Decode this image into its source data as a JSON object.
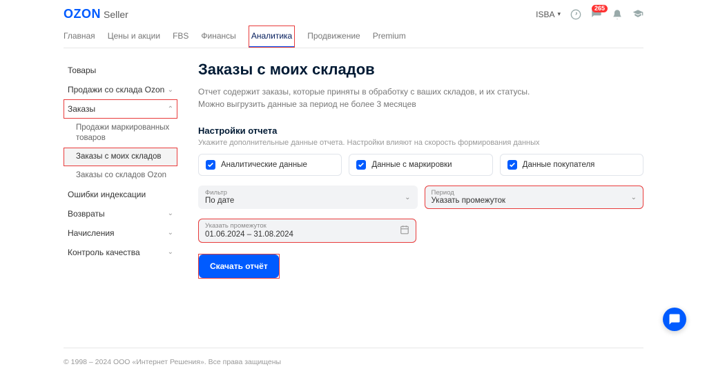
{
  "header": {
    "logo_main": "OZON",
    "logo_sub": "Seller",
    "user": "ISBA",
    "badge_count": "265"
  },
  "tabs": [
    "Главная",
    "Цены и акции",
    "FBS",
    "Финансы",
    "Аналитика",
    "Продвижение",
    "Premium"
  ],
  "active_tab_index": 4,
  "sidebar": {
    "items": [
      {
        "label": "Товары"
      },
      {
        "label": "Продажи со склада Ozon",
        "chev": "down"
      },
      {
        "label": "Заказы",
        "chev": "up",
        "highlight": true
      },
      {
        "label": "Ошибки индексации"
      },
      {
        "label": "Возвраты",
        "chev": "down"
      },
      {
        "label": "Начисления",
        "chev": "down"
      },
      {
        "label": "Контроль качества",
        "chev": "down"
      }
    ],
    "sub_items": [
      "Продажи маркированных товаров",
      "Заказы с моих складов",
      "Заказы со складов Ozon"
    ]
  },
  "content": {
    "title": "Заказы с моих складов",
    "description": "Отчет содержит заказы, которые приняты в обработку с ваших складов, и их статусы. Можно выгрузить данные за период не более 3 месяцев",
    "settings_head": "Настройки отчета",
    "settings_desc": "Укажите дополнительные данные отчета. Настройки влияют на скорость формирования данных",
    "checks": [
      "Аналитические данные",
      "Данные с маркировки",
      "Данные покупателя"
    ],
    "filter": {
      "label": "Фильтр",
      "value": "По дате"
    },
    "period": {
      "label": "Период",
      "value": "Указать промежуток"
    },
    "date_range": {
      "label": "Указать промежуток",
      "value": "01.06.2024 – 31.08.2024"
    },
    "download_btn": "Скачать отчёт"
  },
  "footer": "© 1998 – 2024 ООО «Интернет Решения». Все права защищены"
}
